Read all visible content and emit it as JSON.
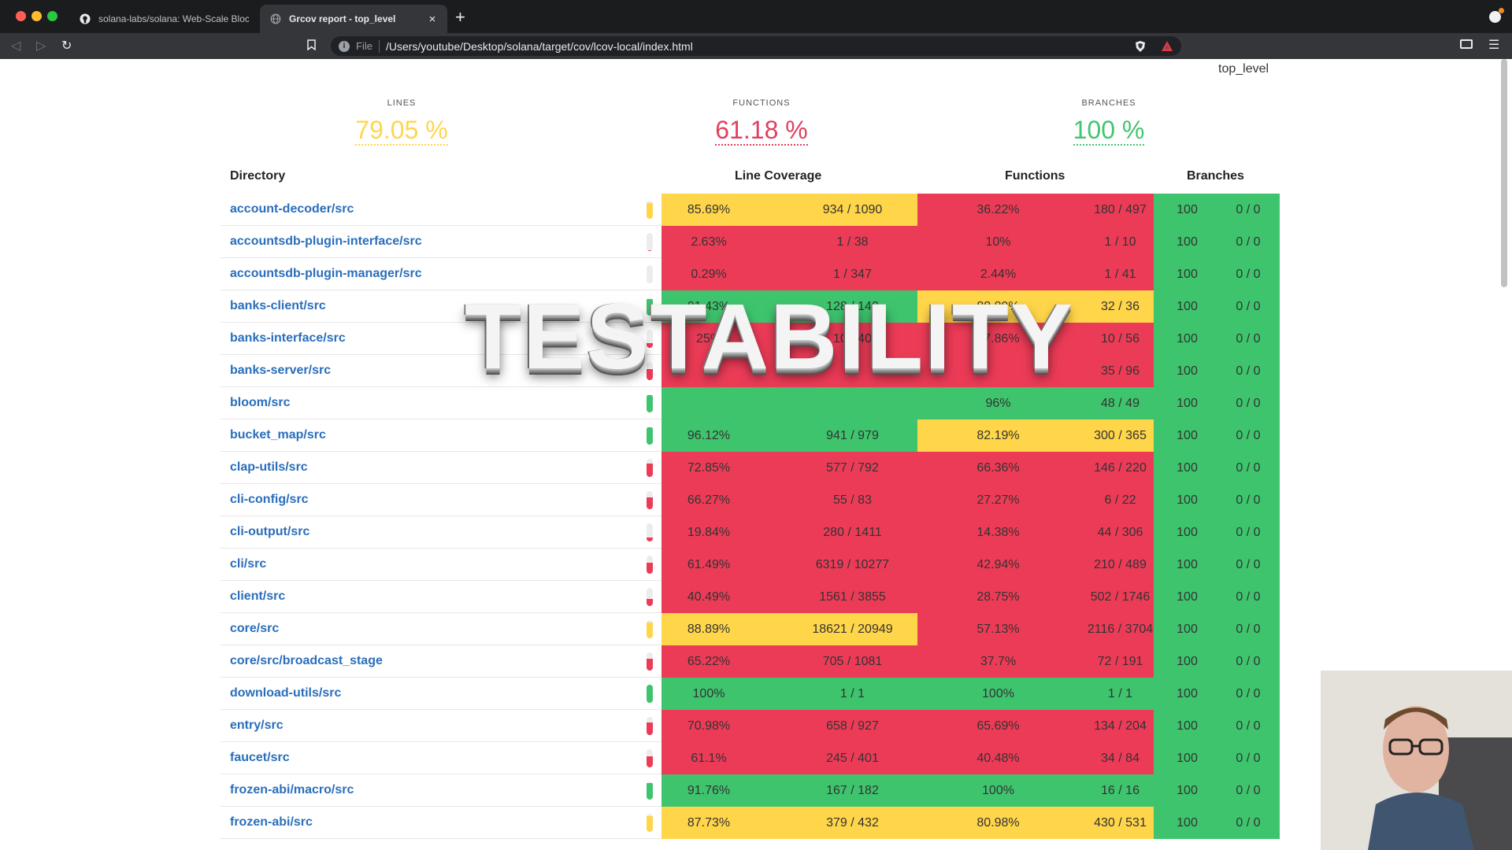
{
  "browser": {
    "tabs": [
      {
        "title": "solana-labs/solana: Web-Scale Blockchain",
        "icon": "github-icon"
      },
      {
        "title": "Grcov report - top_level",
        "icon": "globe-icon"
      }
    ],
    "omnibox": {
      "scheme": "File",
      "url": "/Users/youtube/Desktop/solana/target/cov/lcov-local/index.html"
    }
  },
  "page": {
    "breadcrumb": "top_level",
    "summary": {
      "lines": {
        "label": "LINES",
        "value": "79.05 %"
      },
      "functions": {
        "label": "FUNCTIONS",
        "value": "61.18 %"
      },
      "branches": {
        "label": "BRANCHES",
        "value": "100 %"
      }
    },
    "headers": {
      "directory": "Directory",
      "line_coverage": "Line Coverage",
      "functions": "Functions",
      "branches": "Branches"
    },
    "overlay_text": "TESTABILITY",
    "rows": [
      {
        "dir": "account-decoder/src",
        "lpct": "85.69%",
        "lfrac": "934 / 1090",
        "fpct": "36.22%",
        "ffrac": "180 / 497",
        "bpct": "100",
        "bfrac": "0 / 0",
        "lcolor": "y",
        "fcolor": "r",
        "bar": 0.8569
      },
      {
        "dir": "accountsdb-plugin-interface/src",
        "lpct": "2.63%",
        "lfrac": "1 / 38",
        "fpct": "10%",
        "ffrac": "1 / 10",
        "bpct": "100",
        "bfrac": "0 / 0",
        "lcolor": "r",
        "fcolor": "r",
        "bar": 0.0263
      },
      {
        "dir": "accountsdb-plugin-manager/src",
        "lpct": "0.29%",
        "lfrac": "1 / 347",
        "fpct": "2.44%",
        "ffrac": "1 / 41",
        "bpct": "100",
        "bfrac": "0 / 0",
        "lcolor": "r",
        "fcolor": "r",
        "bar": 0.0029
      },
      {
        "dir": "banks-client/src",
        "lpct": "91.43%",
        "lfrac": "128 / 140",
        "fpct": "88.89%",
        "ffrac": "32 / 36",
        "bpct": "100",
        "bfrac": "0 / 0",
        "lcolor": "g",
        "fcolor": "y",
        "bar": 0.9143
      },
      {
        "dir": "banks-interface/src",
        "lpct": "25%",
        "lfrac": "10 / 40",
        "fpct": "17.86%",
        "ffrac": "10 / 56",
        "bpct": "100",
        "bfrac": "0 / 0",
        "lcolor": "r",
        "fcolor": "r",
        "bar": 0.25
      },
      {
        "dir": "banks-server/src",
        "lpct": "",
        "lfrac": "",
        "fpct": "",
        "ffrac": "35 / 96",
        "bpct": "100",
        "bfrac": "0 / 0",
        "lcolor": "r",
        "fcolor": "r",
        "bar": 0.6
      },
      {
        "dir": "bloom/src",
        "lpct": "",
        "lfrac": "",
        "fpct": "96%",
        "ffrac": "48 / 49",
        "bpct": "100",
        "bfrac": "0 / 0",
        "lcolor": "g",
        "fcolor": "g",
        "bar": 0.95
      },
      {
        "dir": "bucket_map/src",
        "lpct": "96.12%",
        "lfrac": "941 / 979",
        "fpct": "82.19%",
        "ffrac": "300 / 365",
        "bpct": "100",
        "bfrac": "0 / 0",
        "lcolor": "g",
        "fcolor": "y",
        "bar": 0.9612
      },
      {
        "dir": "clap-utils/src",
        "lpct": "72.85%",
        "lfrac": "577 / 792",
        "fpct": "66.36%",
        "ffrac": "146 / 220",
        "bpct": "100",
        "bfrac": "0 / 0",
        "lcolor": "r",
        "fcolor": "r",
        "bar": 0.7285
      },
      {
        "dir": "cli-config/src",
        "lpct": "66.27%",
        "lfrac": "55 / 83",
        "fpct": "27.27%",
        "ffrac": "6 / 22",
        "bpct": "100",
        "bfrac": "0 / 0",
        "lcolor": "r",
        "fcolor": "r",
        "bar": 0.6627
      },
      {
        "dir": "cli-output/src",
        "lpct": "19.84%",
        "lfrac": "280 / 1411",
        "fpct": "14.38%",
        "ffrac": "44 / 306",
        "bpct": "100",
        "bfrac": "0 / 0",
        "lcolor": "r",
        "fcolor": "r",
        "bar": 0.1984
      },
      {
        "dir": "cli/src",
        "lpct": "61.49%",
        "lfrac": "6319 / 10277",
        "fpct": "42.94%",
        "ffrac": "210 / 489",
        "bpct": "100",
        "bfrac": "0 / 0",
        "lcolor": "r",
        "fcolor": "r",
        "bar": 0.6149
      },
      {
        "dir": "client/src",
        "lpct": "40.49%",
        "lfrac": "1561 / 3855",
        "fpct": "28.75%",
        "ffrac": "502 / 1746",
        "bpct": "100",
        "bfrac": "0 / 0",
        "lcolor": "r",
        "fcolor": "r",
        "bar": 0.4049
      },
      {
        "dir": "core/src",
        "lpct": "88.89%",
        "lfrac": "18621 / 20949",
        "fpct": "57.13%",
        "ffrac": "2116 / 3704",
        "bpct": "100",
        "bfrac": "0 / 0",
        "lcolor": "y",
        "fcolor": "r",
        "bar": 0.8889
      },
      {
        "dir": "core/src/broadcast_stage",
        "lpct": "65.22%",
        "lfrac": "705 / 1081",
        "fpct": "37.7%",
        "ffrac": "72 / 191",
        "bpct": "100",
        "bfrac": "0 / 0",
        "lcolor": "r",
        "fcolor": "r",
        "bar": 0.6522
      },
      {
        "dir": "download-utils/src",
        "lpct": "100%",
        "lfrac": "1 / 1",
        "fpct": "100%",
        "ffrac": "1 / 1",
        "bpct": "100",
        "bfrac": "0 / 0",
        "lcolor": "g",
        "fcolor": "g",
        "bar": 1.0
      },
      {
        "dir": "entry/src",
        "lpct": "70.98%",
        "lfrac": "658 / 927",
        "fpct": "65.69%",
        "ffrac": "134 / 204",
        "bpct": "100",
        "bfrac": "0 / 0",
        "lcolor": "r",
        "fcolor": "r",
        "bar": 0.7098
      },
      {
        "dir": "faucet/src",
        "lpct": "61.1%",
        "lfrac": "245 / 401",
        "fpct": "40.48%",
        "ffrac": "34 / 84",
        "bpct": "100",
        "bfrac": "0 / 0",
        "lcolor": "r",
        "fcolor": "r",
        "bar": 0.611
      },
      {
        "dir": "frozen-abi/macro/src",
        "lpct": "91.76%",
        "lfrac": "167 / 182",
        "fpct": "100%",
        "ffrac": "16 / 16",
        "bpct": "100",
        "bfrac": "0 / 0",
        "lcolor": "g",
        "fcolor": "g",
        "bar": 0.9176
      },
      {
        "dir": "frozen-abi/src",
        "lpct": "87.73%",
        "lfrac": "379 / 432",
        "fpct": "80.98%",
        "ffrac": "430 / 531",
        "bpct": "100",
        "bfrac": "0 / 0",
        "lcolor": "y",
        "fcolor": "y",
        "bar": 0.8773
      }
    ]
  },
  "colors": {
    "green": "#3ec46d",
    "yellow": "#ffd54a",
    "red": "#ec3b57",
    "link": "#2a6ebb"
  }
}
